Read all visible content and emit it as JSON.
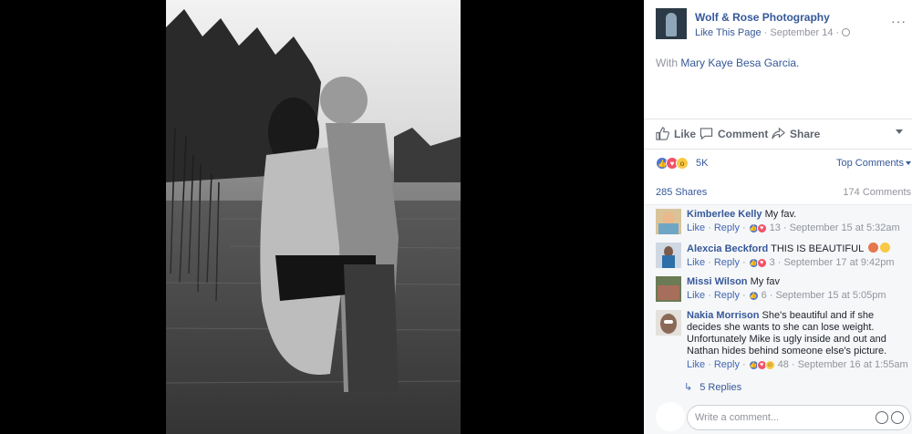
{
  "post": {
    "page_name": "Wolf & Rose Photography",
    "like_page": "Like This Page",
    "date": "September 14",
    "separator": "·",
    "with_prefix": "With",
    "tagged": "Mary Kaye Besa Garcia.",
    "more": "···"
  },
  "actions": {
    "like": "Like",
    "comment": "Comment",
    "share": "Share"
  },
  "reactions": {
    "count": "5K",
    "icons": [
      "like-icon",
      "love-icon",
      "wow-icon"
    ],
    "sort_label": "Top Comments"
  },
  "stats": {
    "shares": "285 Shares",
    "comments": "174 Comments"
  },
  "comments": [
    {
      "author": "Kimberlee Kelly",
      "text": "My fav.",
      "like_label": "Like",
      "reply_label": "Reply",
      "reaction_count": "13",
      "time": "September 15 at 5:32am"
    },
    {
      "author": "Alexcia Beckford",
      "text": "THIS IS BEAUTIFUL",
      "like_label": "Like",
      "reply_label": "Reply",
      "reaction_count": "3",
      "time": "September 17 at 9:42pm"
    },
    {
      "author": "Missi Wilson",
      "text": "My fav",
      "like_label": "Like",
      "reply_label": "Reply",
      "reaction_count": "6",
      "time": "September 15 at 5:05pm"
    },
    {
      "author": "Nakia Morrison",
      "text": "She's beautiful and if she decides she wants to she can lose weight. Unfortunately Mike is ugly inside and out and Nathan hides behind someone else's picture.",
      "like_label": "Like",
      "reply_label": "Reply",
      "reaction_count": "48",
      "time": "September 16 at 1:55am",
      "replies": "5 Replies"
    }
  ],
  "composer": {
    "placeholder": "Write a comment..."
  },
  "colors": {
    "link": "#365899",
    "meta": "#90949c",
    "like_reaction": "#4b76d1",
    "love_reaction": "#f25268",
    "wow_reaction": "#f7c944"
  }
}
